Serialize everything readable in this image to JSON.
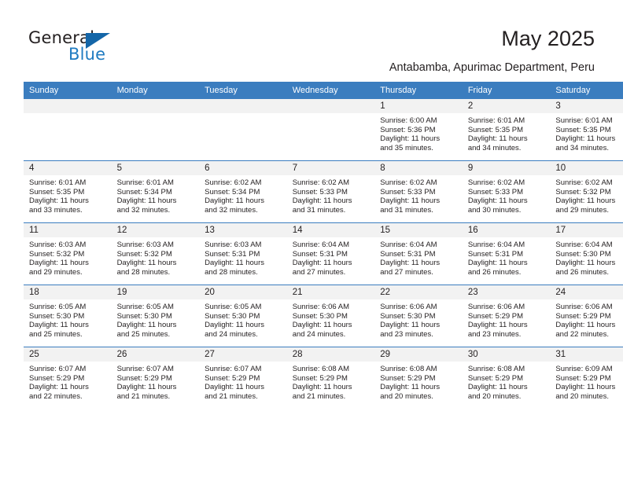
{
  "brand": {
    "name_part1": "General",
    "name_part2": "Blue",
    "triangle_icon": "triangle-icon",
    "accent_color": "#1f7bc1"
  },
  "header": {
    "title": "May 2025",
    "subtitle": "Antabamba, Apurimac Department, Peru"
  },
  "calendar": {
    "header_bg_color": "#3b7dbf",
    "daynum_band_color": "#f2f2f2",
    "weekday_headers": [
      "Sunday",
      "Monday",
      "Tuesday",
      "Wednesday",
      "Thursday",
      "Friday",
      "Saturday"
    ],
    "weeks": [
      [
        {
          "day": "",
          "empty": true
        },
        {
          "day": "",
          "empty": true
        },
        {
          "day": "",
          "empty": true
        },
        {
          "day": "",
          "empty": true
        },
        {
          "day": "1",
          "sunrise": "Sunrise: 6:00 AM",
          "sunset": "Sunset: 5:36 PM",
          "daylight_line1": "Daylight: 11 hours",
          "daylight_line2": "and 35 minutes."
        },
        {
          "day": "2",
          "sunrise": "Sunrise: 6:01 AM",
          "sunset": "Sunset: 5:35 PM",
          "daylight_line1": "Daylight: 11 hours",
          "daylight_line2": "and 34 minutes."
        },
        {
          "day": "3",
          "sunrise": "Sunrise: 6:01 AM",
          "sunset": "Sunset: 5:35 PM",
          "daylight_line1": "Daylight: 11 hours",
          "daylight_line2": "and 34 minutes."
        }
      ],
      [
        {
          "day": "4",
          "sunrise": "Sunrise: 6:01 AM",
          "sunset": "Sunset: 5:35 PM",
          "daylight_line1": "Daylight: 11 hours",
          "daylight_line2": "and 33 minutes."
        },
        {
          "day": "5",
          "sunrise": "Sunrise: 6:01 AM",
          "sunset": "Sunset: 5:34 PM",
          "daylight_line1": "Daylight: 11 hours",
          "daylight_line2": "and 32 minutes."
        },
        {
          "day": "6",
          "sunrise": "Sunrise: 6:02 AM",
          "sunset": "Sunset: 5:34 PM",
          "daylight_line1": "Daylight: 11 hours",
          "daylight_line2": "and 32 minutes."
        },
        {
          "day": "7",
          "sunrise": "Sunrise: 6:02 AM",
          "sunset": "Sunset: 5:33 PM",
          "daylight_line1": "Daylight: 11 hours",
          "daylight_line2": "and 31 minutes."
        },
        {
          "day": "8",
          "sunrise": "Sunrise: 6:02 AM",
          "sunset": "Sunset: 5:33 PM",
          "daylight_line1": "Daylight: 11 hours",
          "daylight_line2": "and 31 minutes."
        },
        {
          "day": "9",
          "sunrise": "Sunrise: 6:02 AM",
          "sunset": "Sunset: 5:33 PM",
          "daylight_line1": "Daylight: 11 hours",
          "daylight_line2": "and 30 minutes."
        },
        {
          "day": "10",
          "sunrise": "Sunrise: 6:02 AM",
          "sunset": "Sunset: 5:32 PM",
          "daylight_line1": "Daylight: 11 hours",
          "daylight_line2": "and 29 minutes."
        }
      ],
      [
        {
          "day": "11",
          "sunrise": "Sunrise: 6:03 AM",
          "sunset": "Sunset: 5:32 PM",
          "daylight_line1": "Daylight: 11 hours",
          "daylight_line2": "and 29 minutes."
        },
        {
          "day": "12",
          "sunrise": "Sunrise: 6:03 AM",
          "sunset": "Sunset: 5:32 PM",
          "daylight_line1": "Daylight: 11 hours",
          "daylight_line2": "and 28 minutes."
        },
        {
          "day": "13",
          "sunrise": "Sunrise: 6:03 AM",
          "sunset": "Sunset: 5:31 PM",
          "daylight_line1": "Daylight: 11 hours",
          "daylight_line2": "and 28 minutes."
        },
        {
          "day": "14",
          "sunrise": "Sunrise: 6:04 AM",
          "sunset": "Sunset: 5:31 PM",
          "daylight_line1": "Daylight: 11 hours",
          "daylight_line2": "and 27 minutes."
        },
        {
          "day": "15",
          "sunrise": "Sunrise: 6:04 AM",
          "sunset": "Sunset: 5:31 PM",
          "daylight_line1": "Daylight: 11 hours",
          "daylight_line2": "and 27 minutes."
        },
        {
          "day": "16",
          "sunrise": "Sunrise: 6:04 AM",
          "sunset": "Sunset: 5:31 PM",
          "daylight_line1": "Daylight: 11 hours",
          "daylight_line2": "and 26 minutes."
        },
        {
          "day": "17",
          "sunrise": "Sunrise: 6:04 AM",
          "sunset": "Sunset: 5:30 PM",
          "daylight_line1": "Daylight: 11 hours",
          "daylight_line2": "and 26 minutes."
        }
      ],
      [
        {
          "day": "18",
          "sunrise": "Sunrise: 6:05 AM",
          "sunset": "Sunset: 5:30 PM",
          "daylight_line1": "Daylight: 11 hours",
          "daylight_line2": "and 25 minutes."
        },
        {
          "day": "19",
          "sunrise": "Sunrise: 6:05 AM",
          "sunset": "Sunset: 5:30 PM",
          "daylight_line1": "Daylight: 11 hours",
          "daylight_line2": "and 25 minutes."
        },
        {
          "day": "20",
          "sunrise": "Sunrise: 6:05 AM",
          "sunset": "Sunset: 5:30 PM",
          "daylight_line1": "Daylight: 11 hours",
          "daylight_line2": "and 24 minutes."
        },
        {
          "day": "21",
          "sunrise": "Sunrise: 6:06 AM",
          "sunset": "Sunset: 5:30 PM",
          "daylight_line1": "Daylight: 11 hours",
          "daylight_line2": "and 24 minutes."
        },
        {
          "day": "22",
          "sunrise": "Sunrise: 6:06 AM",
          "sunset": "Sunset: 5:30 PM",
          "daylight_line1": "Daylight: 11 hours",
          "daylight_line2": "and 23 minutes."
        },
        {
          "day": "23",
          "sunrise": "Sunrise: 6:06 AM",
          "sunset": "Sunset: 5:29 PM",
          "daylight_line1": "Daylight: 11 hours",
          "daylight_line2": "and 23 minutes."
        },
        {
          "day": "24",
          "sunrise": "Sunrise: 6:06 AM",
          "sunset": "Sunset: 5:29 PM",
          "daylight_line1": "Daylight: 11 hours",
          "daylight_line2": "and 22 minutes."
        }
      ],
      [
        {
          "day": "25",
          "sunrise": "Sunrise: 6:07 AM",
          "sunset": "Sunset: 5:29 PM",
          "daylight_line1": "Daylight: 11 hours",
          "daylight_line2": "and 22 minutes."
        },
        {
          "day": "26",
          "sunrise": "Sunrise: 6:07 AM",
          "sunset": "Sunset: 5:29 PM",
          "daylight_line1": "Daylight: 11 hours",
          "daylight_line2": "and 21 minutes."
        },
        {
          "day": "27",
          "sunrise": "Sunrise: 6:07 AM",
          "sunset": "Sunset: 5:29 PM",
          "daylight_line1": "Daylight: 11 hours",
          "daylight_line2": "and 21 minutes."
        },
        {
          "day": "28",
          "sunrise": "Sunrise: 6:08 AM",
          "sunset": "Sunset: 5:29 PM",
          "daylight_line1": "Daylight: 11 hours",
          "daylight_line2": "and 21 minutes."
        },
        {
          "day": "29",
          "sunrise": "Sunrise: 6:08 AM",
          "sunset": "Sunset: 5:29 PM",
          "daylight_line1": "Daylight: 11 hours",
          "daylight_line2": "and 20 minutes."
        },
        {
          "day": "30",
          "sunrise": "Sunrise: 6:08 AM",
          "sunset": "Sunset: 5:29 PM",
          "daylight_line1": "Daylight: 11 hours",
          "daylight_line2": "and 20 minutes."
        },
        {
          "day": "31",
          "sunrise": "Sunrise: 6:09 AM",
          "sunset": "Sunset: 5:29 PM",
          "daylight_line1": "Daylight: 11 hours",
          "daylight_line2": "and 20 minutes."
        }
      ]
    ]
  }
}
